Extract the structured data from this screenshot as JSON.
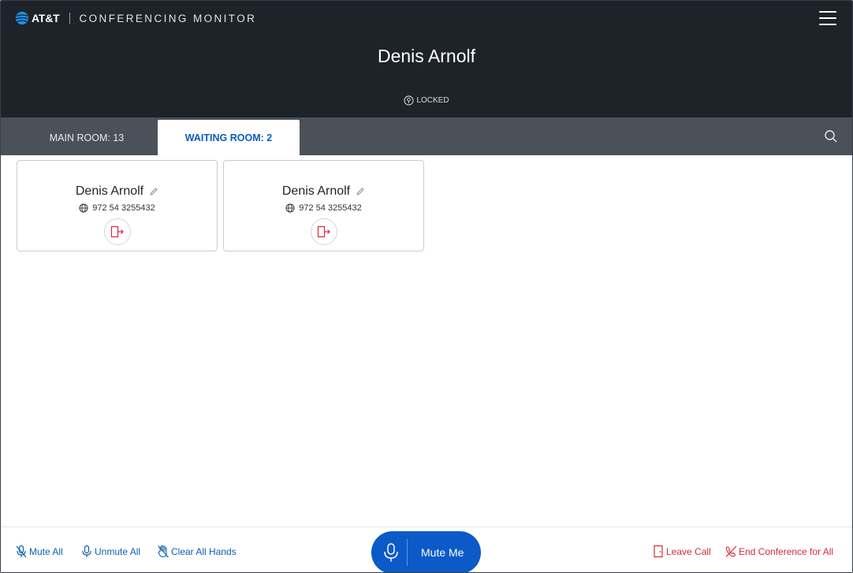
{
  "header": {
    "brand": "AT&T",
    "app_title": "CONFERENCING MONITOR",
    "host_name": "Denis Arnolf",
    "lock_status": "LOCKED"
  },
  "tabs": [
    {
      "label": "MAIN ROOM: 13",
      "active": false
    },
    {
      "label": "WAITING ROOM: 2",
      "active": true
    }
  ],
  "participants": [
    {
      "name": "Denis Arnolf",
      "phone": "972 54 3255432"
    },
    {
      "name": "Denis Arnolf",
      "phone": "972 54 3255432"
    }
  ],
  "footer": {
    "mute_all": "Mute All",
    "unmute_all": "Unmute All",
    "clear_all_hands": "Clear All Hands",
    "mute_me": "Mute Me",
    "leave_call": "Leave Call",
    "end_conference": "End Conference for All"
  },
  "colors": {
    "header_bg": "#1d2329",
    "tabs_bg": "#4a5159",
    "accent_blue": "#0b5db8",
    "danger_red": "#d4293d"
  },
  "icons": [
    "att-globe-icon",
    "hamburger-menu-icon",
    "lock-icon",
    "search-icon",
    "pencil-icon",
    "globe-icon",
    "admit-door-icon",
    "mic-off-icon",
    "mic-icon",
    "hand-off-icon",
    "door-icon",
    "phone-off-icon"
  ]
}
